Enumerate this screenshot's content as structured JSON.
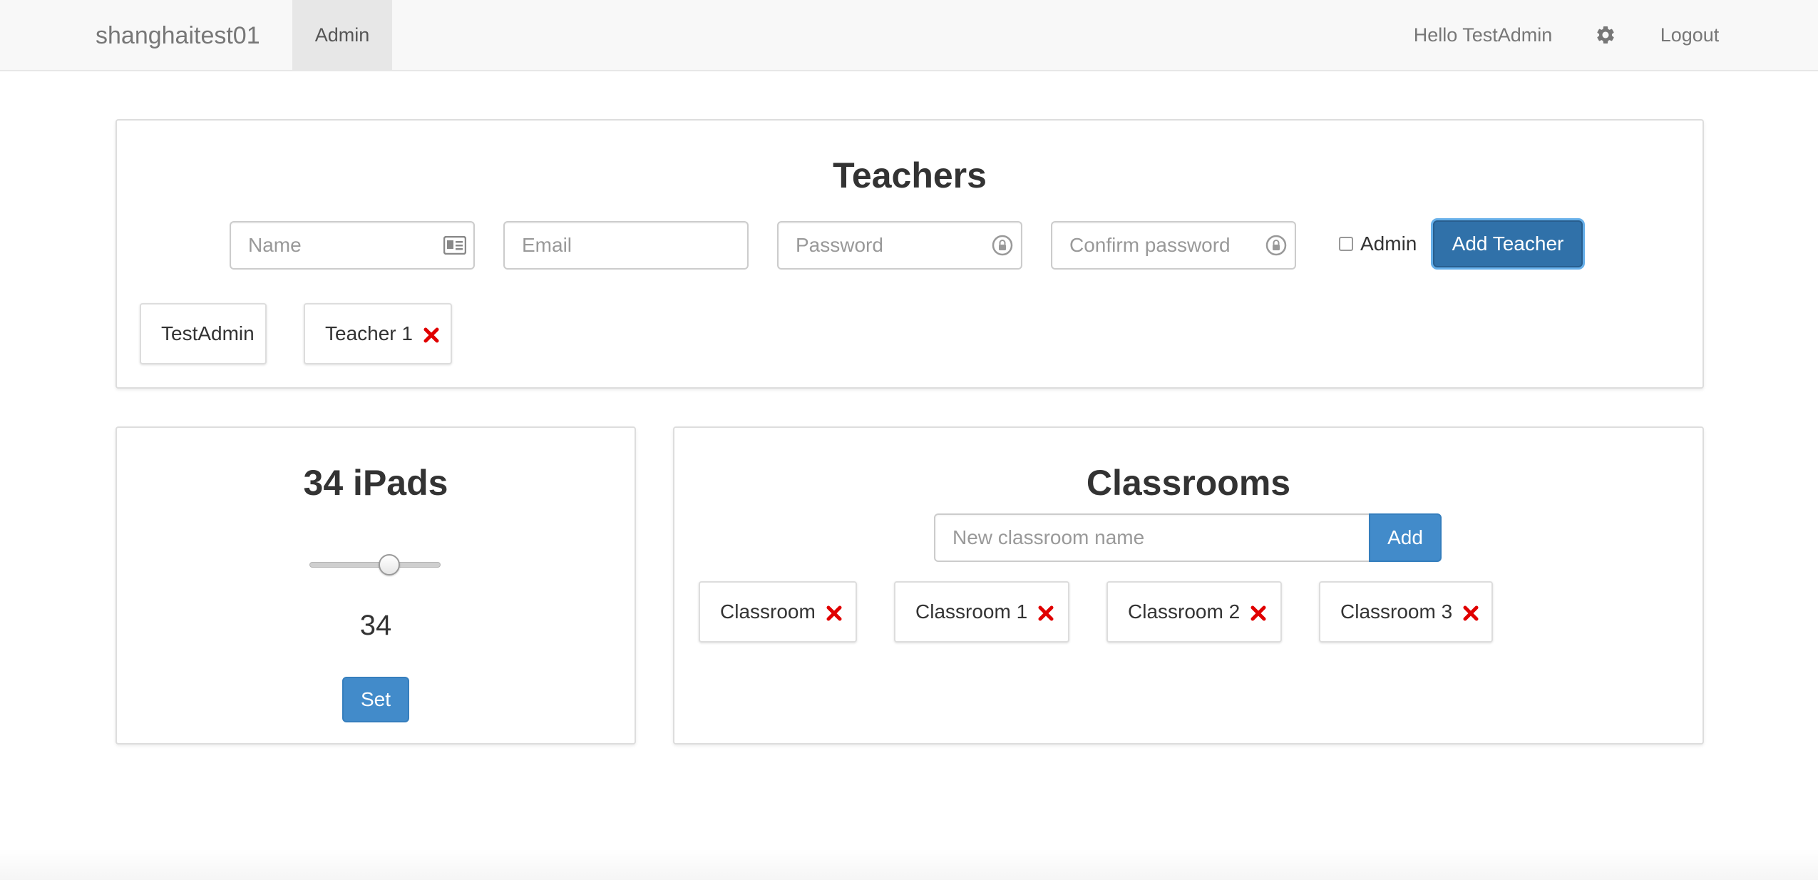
{
  "navbar": {
    "brand": "shanghaitest01",
    "active_tab": "Admin",
    "greeting": "Hello TestAdmin",
    "settings_icon": "gear-icon",
    "logout": "Logout"
  },
  "teachers": {
    "title": "Teachers",
    "name_placeholder": "Name",
    "email_placeholder": "Email",
    "password_placeholder": "Password",
    "confirm_placeholder": "Confirm password",
    "admin_checkbox_label": "Admin",
    "admin_checked": false,
    "add_button": "Add Teacher",
    "list": [
      {
        "name": "TestAdmin",
        "removable": false
      },
      {
        "name": "Teacher 1",
        "removable": true
      }
    ]
  },
  "ipads": {
    "title": "34 iPads",
    "slider_value": 34,
    "value_text": "34",
    "set_button": "Set"
  },
  "classrooms": {
    "title": "Classrooms",
    "new_placeholder": "New classroom name",
    "add_button": "Add",
    "list": [
      {
        "name": "Classroom"
      },
      {
        "name": "Classroom 1"
      },
      {
        "name": "Classroom 2"
      },
      {
        "name": "Classroom 3"
      }
    ]
  },
  "colors": {
    "primary": "#428bca",
    "primary_active": "#3071a9",
    "delete_red": "#e00000",
    "navbar_bg": "#f8f8f8"
  }
}
